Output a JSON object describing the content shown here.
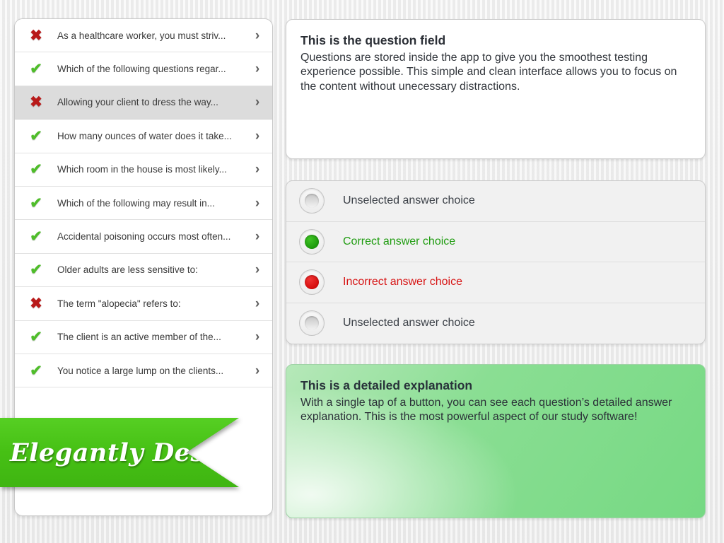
{
  "question_list": {
    "items": [
      {
        "status": "wrong",
        "status_icon": "cross-icon",
        "text": "As a healthcare worker, you must striv...",
        "chevron": "›",
        "selected": false
      },
      {
        "status": "correct",
        "status_icon": "check-icon",
        "text": "Which of the following questions regar...",
        "chevron": "›",
        "selected": false
      },
      {
        "status": "wrong",
        "status_icon": "cross-icon",
        "text": "Allowing your client to dress the way...",
        "chevron": "›",
        "selected": true
      },
      {
        "status": "correct",
        "status_icon": "check-icon",
        "text": "How many ounces of water does it take...",
        "chevron": "›",
        "selected": false
      },
      {
        "status": "correct",
        "status_icon": "check-icon",
        "text": "Which room in the house is most likely...",
        "chevron": "›",
        "selected": false
      },
      {
        "status": "correct",
        "status_icon": "check-icon",
        "text": "Which of the following may result in...",
        "chevron": "›",
        "selected": false
      },
      {
        "status": "correct",
        "status_icon": "check-icon",
        "text": "Accidental poisoning occurs most often...",
        "chevron": "›",
        "selected": false
      },
      {
        "status": "correct",
        "status_icon": "check-icon",
        "text": "Older adults are less sensitive to:",
        "chevron": "›",
        "selected": false
      },
      {
        "status": "wrong",
        "status_icon": "cross-icon",
        "text": "The term \"alopecia\" refers to:",
        "chevron": "›",
        "selected": false
      },
      {
        "status": "correct",
        "status_icon": "check-icon",
        "text": "The client is an active member of the...",
        "chevron": "›",
        "selected": false
      },
      {
        "status": "correct",
        "status_icon": "check-icon",
        "text": "You notice a large lump on the clients...",
        "chevron": "›",
        "selected": false
      }
    ],
    "check_glyph": "✔",
    "cross_glyph": "✖"
  },
  "ribbon": {
    "label": "Elegantly Designed",
    "color": "#46c014",
    "text_color": "#ffffff"
  },
  "question_panel": {
    "title": "This is the question field",
    "body": "Questions are stored inside the app to give you the smoothest testing experience possible. This simple and clean interface allows you to focus on the content without unecessary distractions."
  },
  "answers_panel": {
    "choices": [
      {
        "label": "Unselected answer choice",
        "state": "unselected"
      },
      {
        "label": "Correct answer choice",
        "state": "correct"
      },
      {
        "label": "Incorrect answer choice",
        "state": "incorrect"
      },
      {
        "label": "Unselected answer choice",
        "state": "unselected"
      }
    ],
    "correct_color": "#1f9c10",
    "incorrect_color": "#d71616"
  },
  "explanation_panel": {
    "title": "This is a detailed explanation",
    "body": "With a single tap of a button, you can see each question’s detailed answer explanation. This is the most powerful aspect of our study software!",
    "background_color": "#8ade93"
  }
}
